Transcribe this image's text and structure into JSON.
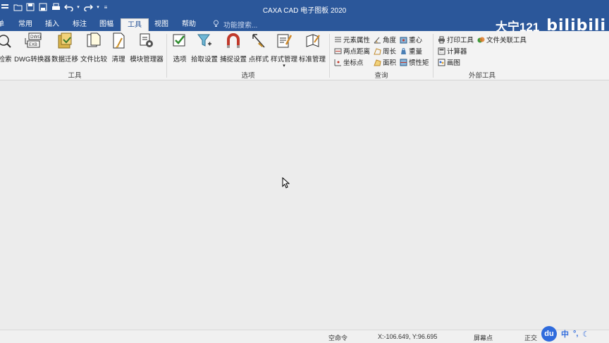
{
  "window": {
    "title": "CAXA CAD 电子图板 2020"
  },
  "tabs": [
    {
      "label": "单"
    },
    {
      "label": "常用"
    },
    {
      "label": "插入"
    },
    {
      "label": "标注"
    },
    {
      "label": "图幅"
    },
    {
      "label": "工具",
      "active": true
    },
    {
      "label": "视图"
    },
    {
      "label": "帮助"
    }
  ],
  "tell_me": {
    "placeholder": "功能搜索..."
  },
  "watermark": {
    "user": "大宁121",
    "logo": "bilibili"
  },
  "ribbon": {
    "tools": {
      "label": "工具",
      "buttons": [
        {
          "label": "检索",
          "icon": "search-icon"
        },
        {
          "label": "DWG转换器",
          "icon": "dwg-exb-convert-icon"
        },
        {
          "label": "数据迁移",
          "icon": "data-migration-icon"
        },
        {
          "label": "文件比较",
          "icon": "file-compare-icon"
        },
        {
          "label": "清理",
          "icon": "purge-icon"
        },
        {
          "label": "模块管理器",
          "icon": "module-manager-icon"
        }
      ]
    },
    "options": {
      "label": "选项",
      "buttons": [
        {
          "label": "选项",
          "icon": "checkbox-icon"
        },
        {
          "label": "拾取设置",
          "icon": "pick-filter-icon"
        },
        {
          "label": "捕捉设置",
          "icon": "magnet-icon"
        },
        {
          "label": "点样式",
          "icon": "point-style-icon"
        },
        {
          "label": "样式管理",
          "icon": "style-manager-icon"
        },
        {
          "label": "标准管理",
          "icon": "standard-manager-icon"
        }
      ]
    },
    "query": {
      "label": "查询",
      "items": [
        {
          "label": "元素属性"
        },
        {
          "label": "角度"
        },
        {
          "label": "重心"
        },
        {
          "label": "两点距离"
        },
        {
          "label": "周长"
        },
        {
          "label": "重量"
        },
        {
          "label": "坐标点"
        },
        {
          "label": "面积"
        },
        {
          "label": "惯性矩"
        }
      ]
    },
    "external": {
      "label": "外部工具",
      "items": [
        {
          "label": "打印工具"
        },
        {
          "label": "文件关联工具"
        },
        {
          "label": "计算器"
        },
        {
          "label": "画图"
        }
      ]
    }
  },
  "status": {
    "command": "空命令",
    "coords": "X:-106.649, Y:96.695",
    "snap": "屏幕点",
    "view": "正交"
  },
  "ime": {
    "badge": "du",
    "lang": "中",
    "punct": "°,",
    "width": "☾"
  }
}
